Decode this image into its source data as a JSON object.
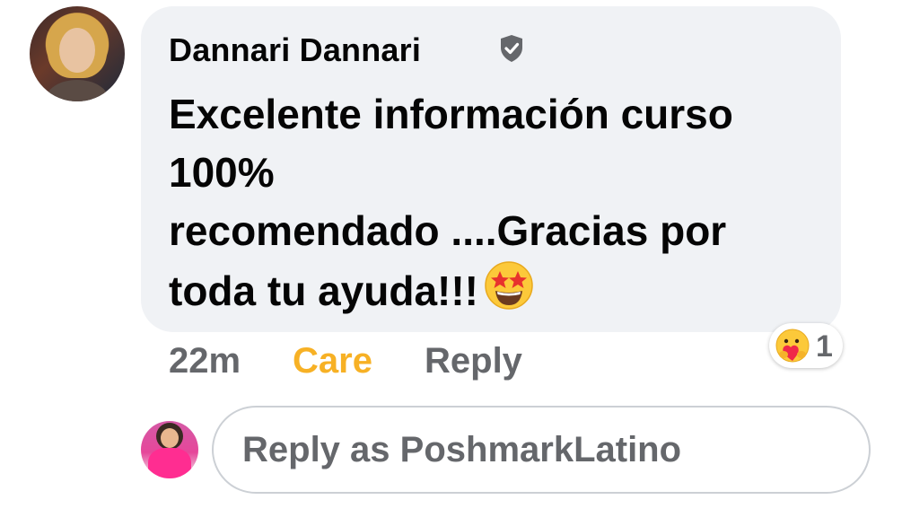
{
  "comment": {
    "author": "Dannari Dannari",
    "author_badge_icon": "verified-shield-icon",
    "text": "Excelente información curso\n100%\nrecomendado ....Gracias por\ntoda tu ayuda!!!",
    "text_emoji_icon": "star-struck-emoji-icon",
    "timestamp": "22m",
    "reaction_label": "Care",
    "reply_label": "Reply",
    "reaction_count": "1",
    "reaction_icon": "care-hug-emoji-icon"
  },
  "reply_box": {
    "placeholder": "Reply as PoshmarkLatino",
    "value": ""
  },
  "colors": {
    "bubble_bg": "#f0f2f5",
    "text_primary": "#050505",
    "text_secondary": "#65676b",
    "care_accent": "#f7b125",
    "input_border": "#ccd0d5"
  }
}
